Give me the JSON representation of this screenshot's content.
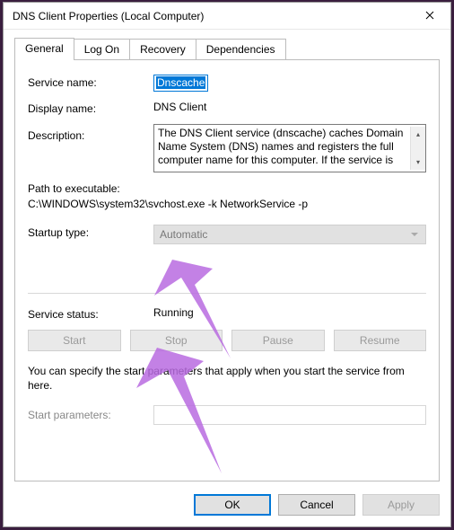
{
  "window": {
    "title": "DNS Client Properties (Local Computer)"
  },
  "tabs": {
    "general": "General",
    "log_on": "Log On",
    "recovery": "Recovery",
    "dependencies": "Dependencies"
  },
  "fields": {
    "service_name_label": "Service name:",
    "service_name_value": "Dnscache",
    "display_name_label": "Display name:",
    "display_name_value": "DNS Client",
    "description_label": "Description:",
    "description_value": "The DNS Client service (dnscache) caches Domain Name System (DNS) names and registers the full computer name for this computer. If the service is",
    "path_label": "Path to executable:",
    "path_value": "C:\\WINDOWS\\system32\\svchost.exe -k NetworkService -p",
    "startup_type_label": "Startup type:",
    "startup_type_value": "Automatic",
    "service_status_label": "Service status:",
    "service_status_value": "Running",
    "hint": "You can specify the start parameters that apply when you start the service from here.",
    "start_parameters_label": "Start parameters:",
    "start_parameters_value": ""
  },
  "buttons": {
    "start": "Start",
    "stop": "Stop",
    "pause": "Pause",
    "resume": "Resume",
    "ok": "OK",
    "cancel": "Cancel",
    "apply": "Apply"
  }
}
